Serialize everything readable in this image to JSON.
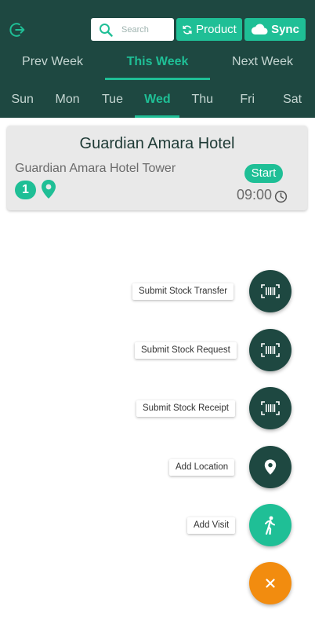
{
  "header": {
    "search_placeholder": "Search",
    "product_label": "Product",
    "sync_label": "Sync",
    "weeks": [
      "Prev Week",
      "This Week",
      "Next Week"
    ],
    "active_week": "This Week",
    "days": [
      "Sun",
      "Mon",
      "Tue",
      "Wed",
      "Thu",
      "Fri",
      "Sat"
    ],
    "active_day": "Wed"
  },
  "card": {
    "title": "Guardian Amara Hotel",
    "subtitle": "Guardian Amara Hotel Tower",
    "badge_count": "1",
    "start_label": "Start",
    "time": "09:00"
  },
  "fab_menu": {
    "items": [
      {
        "label": "Submit Stock Transfer",
        "icon": "barcode-icon"
      },
      {
        "label": "Submit Stock Request",
        "icon": "barcode-icon"
      },
      {
        "label": "Submit Stock Receipt",
        "icon": "barcode-icon"
      },
      {
        "label": "Add Location",
        "icon": "location-pin-icon"
      },
      {
        "label": "Add Visit",
        "icon": "walking-person-icon"
      }
    ],
    "close_icon": "close-icon"
  },
  "colors": {
    "header_bg": "#1e4841",
    "accent": "#1fbf96",
    "close_fab": "#f28c0f"
  }
}
